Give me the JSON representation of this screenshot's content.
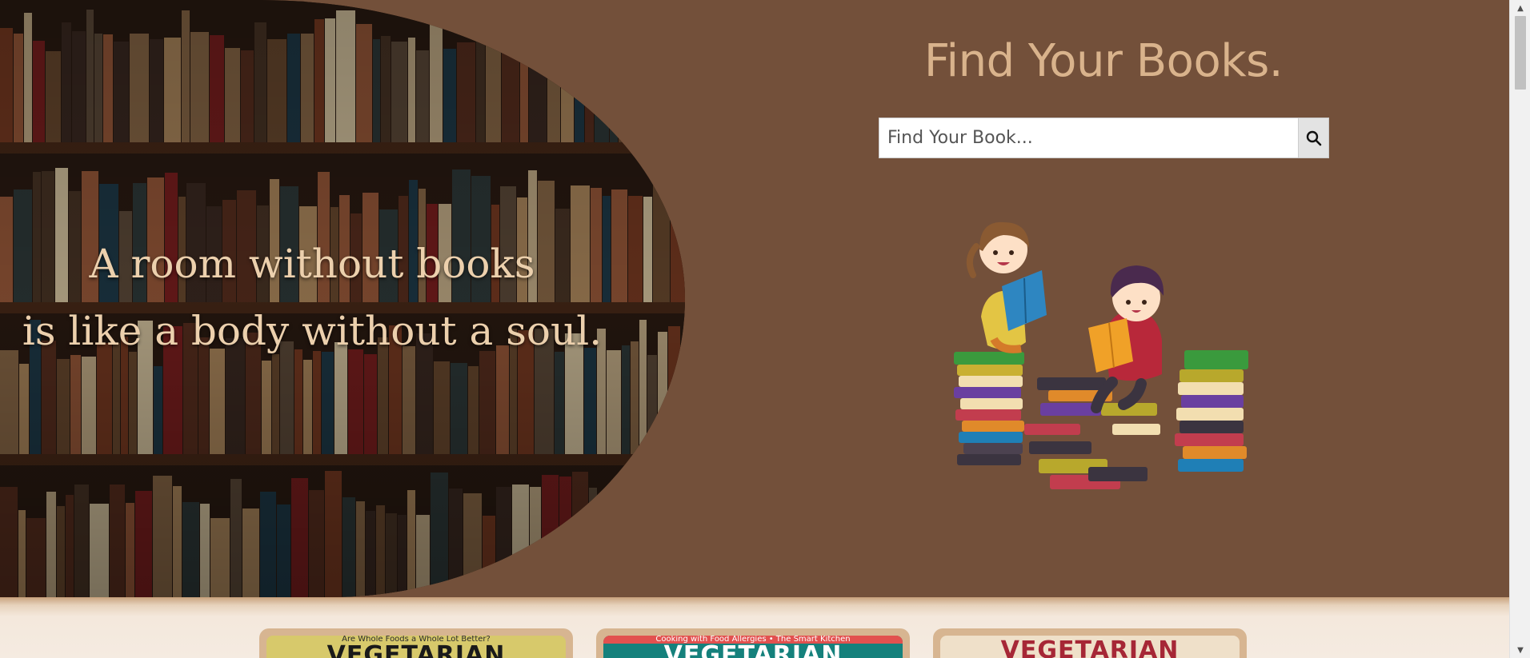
{
  "hero": {
    "quote_line1": "A room without books",
    "quote_line2": "is like a body without a soul."
  },
  "search": {
    "title": "Find Your Books.",
    "placeholder": "Find Your Book...",
    "button_icon": "search-icon"
  },
  "books": [
    {
      "top_text": "Are Whole Foods a Whole Lot Better?",
      "title": "VEGETARIAN"
    },
    {
      "top_text": "Cooking with Food Allergies • The Smart Kitchen",
      "title": "VEGETARIAN"
    },
    {
      "top_text": "",
      "title": "VEGETARIAN"
    }
  ],
  "colors": {
    "background": "#73503a",
    "accent_text": "#d9b38c",
    "quote_text": "#ecd0ad"
  }
}
